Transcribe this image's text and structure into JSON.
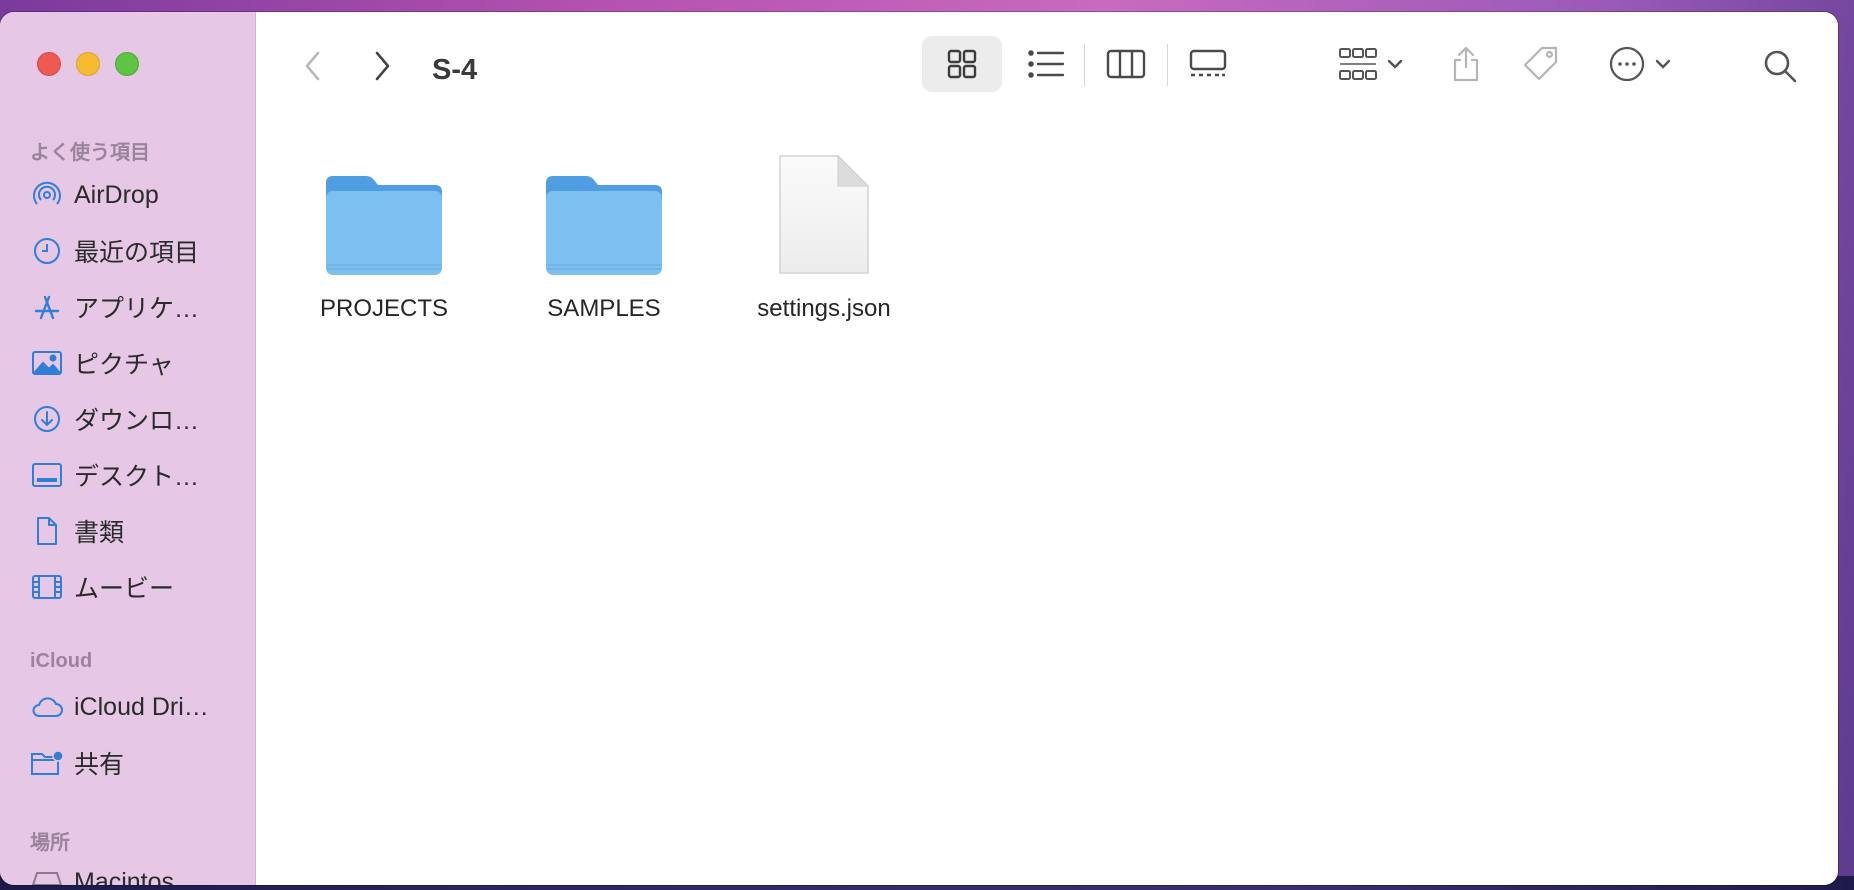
{
  "window": {
    "title": "S-4"
  },
  "sidebar": {
    "favorites_header": "よく使う項目",
    "favorites": [
      {
        "label": "AirDrop",
        "icon": "airdrop-icon"
      },
      {
        "label": "最近の項目",
        "icon": "clock-icon"
      },
      {
        "label": "アプリケ…",
        "icon": "applications-icon"
      },
      {
        "label": "ピクチャ",
        "icon": "photo-icon"
      },
      {
        "label": "ダウンロ…",
        "icon": "download-icon"
      },
      {
        "label": "デスクト…",
        "icon": "desktop-icon"
      },
      {
        "label": "書類",
        "icon": "document-icon"
      },
      {
        "label": "ムービー",
        "icon": "film-icon"
      }
    ],
    "icloud_header": "iCloud",
    "icloud": [
      {
        "label": "iCloud Dri…",
        "icon": "cloud-icon"
      },
      {
        "label": "共有",
        "icon": "shared-folder-icon"
      }
    ],
    "locations_header": "場所",
    "locations": [
      {
        "label": "Macintos…",
        "icon": "disk-icon"
      }
    ]
  },
  "toolbar": {
    "back": "chevron-left-icon",
    "forward": "chevron-right-icon",
    "view_modes": [
      "icon-view-icon",
      "list-view-icon",
      "column-view-icon",
      "gallery-view-icon"
    ],
    "selected_view": "icon-view-icon",
    "actions": [
      "group-icon",
      "share-icon",
      "tag-icon",
      "more-icon",
      "search-icon"
    ]
  },
  "files": [
    {
      "name": "PROJECTS",
      "kind": "folder"
    },
    {
      "name": "SAMPLES",
      "kind": "folder"
    },
    {
      "name": "settings.json",
      "kind": "document"
    }
  ],
  "colors": {
    "sidebar_bg": "#e6c8e6",
    "accent": "#2f7fd8",
    "folder": "#7cc0f2"
  }
}
